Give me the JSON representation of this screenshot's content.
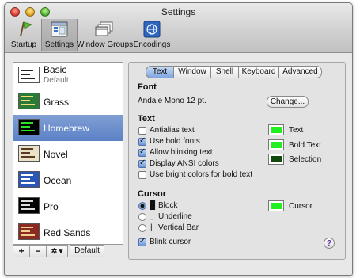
{
  "window": {
    "title": "Settings"
  },
  "toolbar": {
    "items": [
      {
        "label": "Startup",
        "icon": "startup-flag-icon"
      },
      {
        "label": "Settings",
        "icon": "settings-window-icon",
        "selected": true
      },
      {
        "label": "Window Groups",
        "icon": "window-groups-icon"
      },
      {
        "label": "Encodings",
        "icon": "encodings-globe-icon"
      }
    ]
  },
  "profiles": {
    "items": [
      {
        "name": "Basic",
        "subtitle": "Default",
        "bg": "#ffffff",
        "fg": "#222222"
      },
      {
        "name": "Grass",
        "bg": "#2c7a3a",
        "fg": "#f0e070"
      },
      {
        "name": "Homebrew",
        "bg": "#000000",
        "fg": "#28e028",
        "selected": true
      },
      {
        "name": "Novel",
        "bg": "#e9e2c8",
        "fg": "#5a3a20"
      },
      {
        "name": "Ocean",
        "bg": "#2a56b8",
        "fg": "#ffffff"
      },
      {
        "name": "Pro",
        "bg": "#000000",
        "fg": "#dddddd"
      },
      {
        "name": "Red Sands",
        "bg": "#8a2a20",
        "fg": "#f0d090"
      }
    ],
    "buttons": {
      "add": "+",
      "remove": "−",
      "gear": "✲ ▾",
      "default": "Default"
    }
  },
  "tabs": [
    {
      "label": "Text",
      "selected": true
    },
    {
      "label": "Window"
    },
    {
      "label": "Shell"
    },
    {
      "label": "Keyboard"
    },
    {
      "label": "Advanced"
    }
  ],
  "font": {
    "heading": "Font",
    "value": "Andale Mono 12 pt.",
    "change_button": "Change..."
  },
  "text": {
    "heading": "Text",
    "options": [
      {
        "label": "Antialias text",
        "checked": false
      },
      {
        "label": "Use bold fonts",
        "checked": true
      },
      {
        "label": "Allow blinking text",
        "checked": true
      },
      {
        "label": "Display ANSI colors",
        "checked": true
      },
      {
        "label": "Use bright colors for bold text",
        "checked": false
      }
    ],
    "colors": [
      {
        "label": "Text",
        "color": "#22ee22"
      },
      {
        "label": "Bold Text",
        "color": "#22ee22"
      },
      {
        "label": "Selection",
        "color": "#0e4a0e"
      }
    ]
  },
  "cursor": {
    "heading": "Cursor",
    "options": [
      {
        "glyph": "█",
        "label": "Block",
        "selected": true
      },
      {
        "glyph": "_",
        "label": "Underline",
        "selected": false
      },
      {
        "glyph": "|",
        "label": "Vertical Bar",
        "selected": false
      }
    ],
    "color": {
      "label": "Cursor",
      "color": "#22ee22"
    },
    "blink": {
      "label": "Blink cursor",
      "checked": true
    }
  },
  "help": "?"
}
